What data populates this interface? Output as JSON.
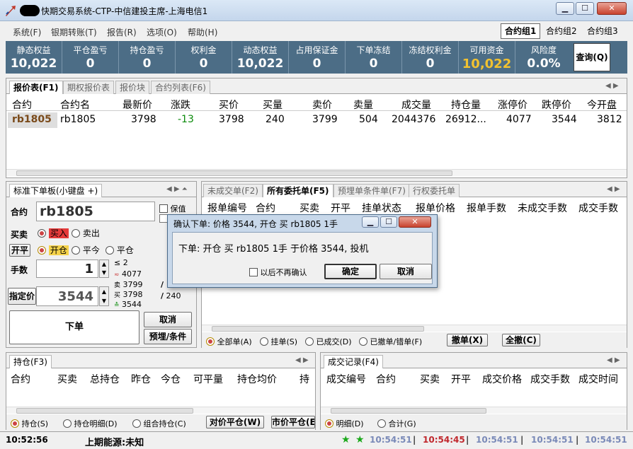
{
  "window": {
    "title": "快期交易系统-CTP-中信建投主席-上海电信1"
  },
  "menu": [
    "系统(F)",
    "银期转账(T)",
    "报告(R)",
    "选项(O)",
    "帮助(H)"
  ],
  "contract_groups": [
    "合约组1",
    "合约组2",
    "合约组3"
  ],
  "stats": [
    {
      "label": "静态权益",
      "value": "10,022"
    },
    {
      "label": "平仓盈亏",
      "value": "0"
    },
    {
      "label": "持仓盈亏",
      "value": "0"
    },
    {
      "label": "权利金",
      "value": "0"
    },
    {
      "label": "动态权益",
      "value": "10,022"
    },
    {
      "label": "占用保证金",
      "value": "0"
    },
    {
      "label": "下单冻结",
      "value": "0"
    },
    {
      "label": "冻结权利金",
      "value": "0"
    },
    {
      "label": "可用资金",
      "value": "10,022"
    },
    {
      "label": "风险度",
      "value": "0.0%"
    }
  ],
  "query_button": "查询(Q)",
  "quote_tabs": [
    "报价表(F1)",
    "期权报价表",
    "报价块",
    "合约列表(F6)"
  ],
  "quote_columns": [
    "合约",
    "合约名",
    "最新价",
    "涨跌",
    "买价",
    "买量",
    "卖价",
    "卖量",
    "成交量",
    "持仓量",
    "涨停价",
    "跌停价",
    "今开盘"
  ],
  "quote_rows": [
    [
      "rb1805",
      "rb1805",
      "3798",
      "-13",
      "3798",
      "240",
      "3799",
      "504",
      "2044376",
      "26912...",
      "4077",
      "3544",
      "3812"
    ]
  ],
  "order_panel": {
    "tab": "标准下单板(小键盘 +)",
    "contract_label": "合约",
    "contract_value": "rb1805",
    "margin_label": "保值",
    "side_label": "买卖",
    "buy": "买入",
    "sell": "卖出",
    "openclose_label": "开平",
    "open": "开仓",
    "close_today": "平今",
    "close": "平仓",
    "qty_label": "手数",
    "qty_value": "1",
    "qty_hint_le": "≤",
    "qty_hint_max": "2",
    "price_label": "指定价",
    "price_value": "3544",
    "upper_limit": "4077",
    "ask_price": "3799",
    "bid_price": "3798",
    "lower_limit": "3544",
    "ask_mark": "卖",
    "bid_mark": "买",
    "bid_vol": "240",
    "slash": "/",
    "submit": "下单",
    "cancel": "取消",
    "condition": "预埋/条件"
  },
  "orders_tabs": [
    "未成交单(F2)",
    "所有委托单(F5)",
    "预埋单条件单(F7)",
    "行权委托单"
  ],
  "orders_columns": [
    "报单编号",
    "合约",
    "买卖",
    "开平",
    "挂单状态",
    "报单价格",
    "报单手数",
    "未成交手数",
    "成交手数"
  ],
  "orders_filters": [
    "全部单(A)",
    "挂单(S)",
    "已成交(D)",
    "已撤单/错单(F)"
  ],
  "orders_buttons": [
    "撤单(X)",
    "全撤(C)"
  ],
  "position_tab": "持仓(F3)",
  "position_columns": [
    "合约",
    "买卖",
    "总持仓",
    "昨仓",
    "今仓",
    "可平量",
    "持仓均价",
    "持"
  ],
  "position_filters": [
    "持仓(S)",
    "持仓明细(D)",
    "组合持仓(C)"
  ],
  "position_buttons": [
    "对价平仓(W)",
    "市价平仓(E)"
  ],
  "trades_tab": "成交记录(F4)",
  "trades_columns": [
    "成交编号",
    "合约",
    "买卖",
    "开平",
    "成交价格",
    "成交手数",
    "成交时间"
  ],
  "trades_filters": [
    "明细(D)",
    "合计(G)"
  ],
  "dialog": {
    "title": "确认下单: 价格 3544, 开仓 买    rb1805 1手",
    "message": "下单: 开仓 买   rb1805 1手 于价格 3544, 投机",
    "no_confirm": "以后不再确认",
    "ok": "确定",
    "cancel": "取消"
  },
  "statusbar": {
    "time": "10:52:56",
    "source": "上期能源:未知",
    "times": [
      "10:54:51",
      "10:54:45",
      "10:54:51",
      "10:54:51",
      "10:54:51"
    ],
    "sep": "|"
  },
  "colors": {
    "stats_bg": "#4c6d86",
    "available_funds": "#f2c230",
    "price_down": "#0a8a0a",
    "buy_red": "#e53a3a"
  }
}
